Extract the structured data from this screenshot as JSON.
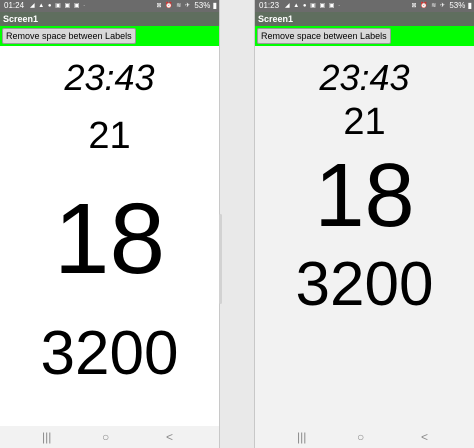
{
  "left_screen": {
    "status": {
      "time": "01:24",
      "left_icons": "◢ ▲ ● ▣ ▣ ▣ ·",
      "right_icons": "⊠ ⏰ ≋ ✈",
      "battery": "53% ▮"
    },
    "title": "Screen1",
    "button_label": "Remove space between Labels",
    "labels": {
      "time": "23:43",
      "date": "21",
      "big": "18",
      "number": "3200"
    },
    "nav": {
      "recents": "|||",
      "home": "○",
      "back": "<"
    }
  },
  "right_screen": {
    "status": {
      "time": "01:23",
      "left_icons": "◢ ▲ ● ▣ ▣ ▣ ·",
      "right_icons": "⊠ ⏰ ≋ ✈",
      "battery": "53% ▮"
    },
    "title": "Screen1",
    "button_label": "Remove space between Labels",
    "labels": {
      "time": "23:43",
      "date": "21",
      "big": "18",
      "number": "3200"
    },
    "nav": {
      "recents": "|||",
      "home": "○",
      "back": "<"
    }
  },
  "colors": {
    "status_bar": "#6b6b6b",
    "title_bar": "#5f6e5e",
    "accent_bar": "#00ff00",
    "button": "#d8d8d8"
  },
  "icons": [
    "recents-icon",
    "home-icon",
    "back-icon",
    "battery-icon",
    "wifi-icon",
    "airplane-icon",
    "alarm-icon"
  ]
}
